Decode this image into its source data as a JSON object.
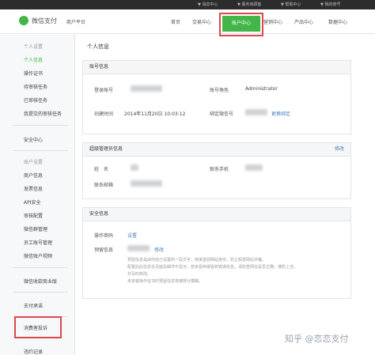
{
  "topbar": {
    "items": [
      "▼ 消息中心",
      "▼ 服务商顾客",
      "▼ 帮助中心",
      "▼ 我的账号"
    ]
  },
  "header": {
    "logo_text": "微信支付",
    "portal": "商户平台",
    "nav": [
      "首页",
      "交易中心",
      "账户中心",
      "营销中心",
      "产品中心",
      "数据中心"
    ],
    "active_nav": "账户中心"
  },
  "sidebar": {
    "group1_title": "个人设置",
    "group1": [
      "个人信息",
      "操作证书",
      "待审核任务",
      "已审核任务",
      "我提交的审核任务"
    ],
    "security": "安全中心",
    "group2_title": "账户设置",
    "group2": [
      "商户信息",
      "发票信息",
      "API安全",
      "审核配置",
      "微信群管理",
      "员工账号管理",
      "微信账户视频"
    ],
    "more": [
      "微信收款商业版",
      "支付承诺",
      "消费者投诉",
      "违约记录"
    ]
  },
  "main": {
    "title": "个人信息",
    "account": {
      "title": "账号信息",
      "login_label": "登录账号",
      "role_label": "账号角色",
      "role_value": "Administrator",
      "created_label": "创建时间",
      "created_value": "2014年11月20日 10:03:12",
      "wechat_label": "绑定微信号",
      "wechat_link": "更换绑定"
    },
    "admin": {
      "title": "超级管理员信息",
      "edit": "修改",
      "name_label": "姓　名",
      "phone_label": "联系手机",
      "email_label": "联系邮箱"
    },
    "security": {
      "title": "安全信息",
      "pwd_label": "操作密码",
      "pwd_link": "设置",
      "reserve_label": "预留信息",
      "reserve_edit": "修改",
      "note_lines": [
        "预留信息是由你自己设置的一段文字，用来鉴别网站身份，防止假冒网站诈骗。",
        "配置后此信息在页面及邮件中显示，若未看到或看到错误信息，请检查网址是否正确，谨防上当，",
        "并及时修改。",
        "未安装操作证书时预留信息将被部分模糊。"
      ]
    }
  },
  "watermark": "知乎 @恋恋支付"
}
